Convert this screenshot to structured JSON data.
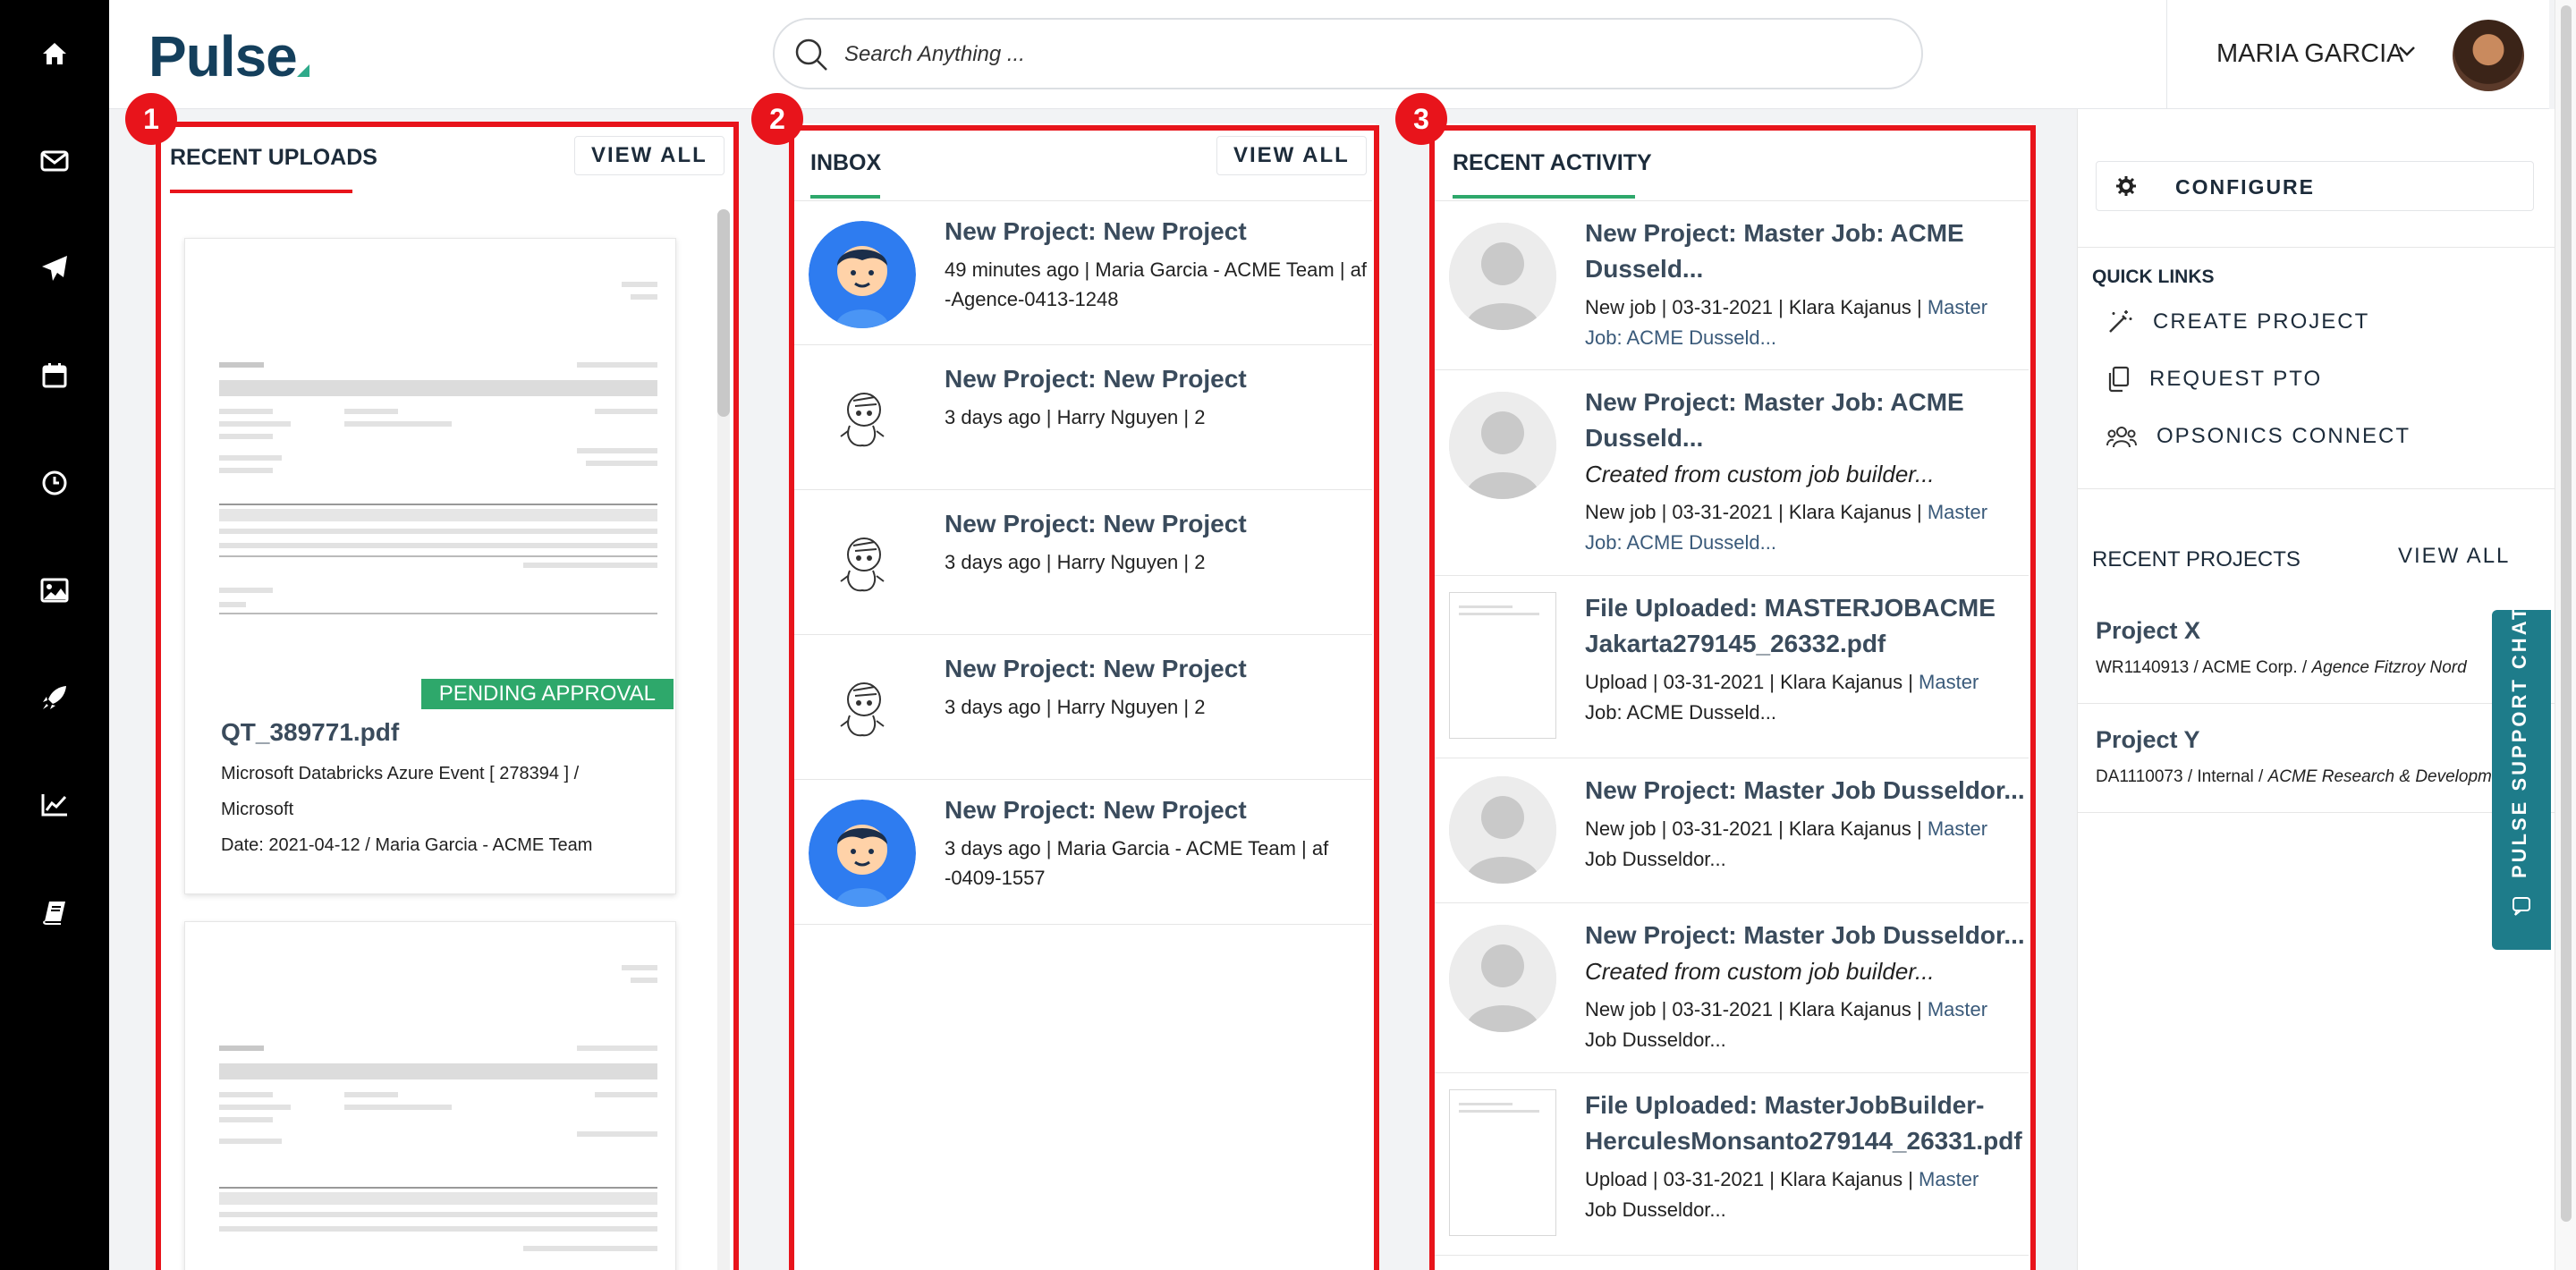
{
  "brand": {
    "name": "Pulse",
    "accent": "#2eaa8a"
  },
  "nav": [
    {
      "icon": "home-icon"
    },
    {
      "icon": "mail-icon"
    },
    {
      "icon": "send-icon"
    },
    {
      "icon": "calendar-icon"
    },
    {
      "icon": "clock-icon"
    },
    {
      "icon": "image-icon"
    },
    {
      "icon": "rocket-icon"
    },
    {
      "icon": "chart-icon"
    },
    {
      "icon": "book-icon"
    }
  ],
  "search": {
    "placeholder": "Search Anything ..."
  },
  "user": {
    "name": "MARIA GARCIA"
  },
  "highlights": {
    "one": "1",
    "two": "2",
    "three": "3",
    "color": "#e8141b"
  },
  "uploads": {
    "title": "RECENT UPLOADS",
    "view_all": "VIEW ALL",
    "items": [
      {
        "status": "PENDING APPROVAL",
        "name": "QT_389771.pdf",
        "meta1": "Microsoft Databricks Azure Event [ 278394 ] /",
        "meta2": "Microsoft",
        "meta3": "Date: 2021-04-12 / Maria Garcia - ACME Team"
      }
    ]
  },
  "inbox": {
    "title": "INBOX",
    "view_all": "VIEW ALL",
    "items": [
      {
        "title": "New Project: New Project",
        "meta1": "49 minutes ago | Maria Garcia - ACME Team | af",
        "meta2": "-Agence-0413-1248"
      },
      {
        "title": "New Project: New Project",
        "meta1": "3 days ago | Harry Nguyen | 2"
      },
      {
        "title": "New Project: New Project",
        "meta1": "3 days ago | Harry Nguyen | 2"
      },
      {
        "title": "New Project: New Project",
        "meta1": "3 days ago | Harry Nguyen | 2"
      },
      {
        "title": "New Project: New Project",
        "meta1": "3 days ago | Maria Garcia - ACME Team | af",
        "meta2": "-0409-1557"
      }
    ]
  },
  "activity": {
    "title": "RECENT ACTIVITY",
    "items": [
      {
        "title1": "New Project: Master Job: ACME",
        "title2": "Dusseld...",
        "meta_a": "New job | 03-31-2021 | Klara Kajanus | ",
        "meta_link_a": "Master",
        "meta_link_b": "Job: ACME Dusseld..."
      },
      {
        "title1": "New Project: Master Job: ACME",
        "title2": "Dusseld...",
        "subtitle": "Created from custom job builder...",
        "meta_a": "New job | 03-31-2021 | Klara Kajanus | ",
        "meta_link_a": "Master",
        "meta_link_b": "Job: ACME Dusseld..."
      },
      {
        "title1": "File Uploaded: MASTERJOBACME",
        "title2": "Jakarta279145_26332.pdf",
        "meta_a": "Upload | 03-31-2021 | Klara Kajanus | ",
        "meta_link_a": "Master",
        "meta_b": "Job: ACME Dusseld..."
      },
      {
        "title1": "New Project: Master Job Dusseldor...",
        "meta_a": "New job | 03-31-2021 | Klara Kajanus | ",
        "meta_link_a": "Master",
        "meta_b": "Job Dusseldor..."
      },
      {
        "title1": "New Project: Master Job Dusseldor...",
        "subtitle": "Created from custom job builder...",
        "meta_a": "New job | 03-31-2021 | Klara Kajanus | ",
        "meta_link_a": "Master",
        "meta_b": "Job Dusseldor..."
      },
      {
        "title1": "File Uploaded: MasterJobBuilder-",
        "title2": "HerculesMonsanto279144_26331.pdf",
        "meta_a": "Upload | 03-31-2021 | Klara Kajanus | ",
        "meta_link_a": "Master",
        "meta_b": "Job Dusseldor..."
      }
    ]
  },
  "sidebar": {
    "configure": "CONFIGURE",
    "quick_links_title": "QUICK LINKS",
    "quick_links": [
      {
        "label": "CREATE PROJECT",
        "icon": "magic-wand-icon"
      },
      {
        "label": "REQUEST PTO",
        "icon": "copy-icon"
      },
      {
        "label": "OPSONICS CONNECT",
        "icon": "users-icon"
      }
    ],
    "recent_projects_title": "RECENT PROJECTS",
    "view_all": "VIEW ALL",
    "projects": [
      {
        "title": "Project X",
        "meta": "WR1140913 / ACME Corp. / ",
        "meta_italic": "Agence Fitzroy Nord"
      },
      {
        "title": "Project Y",
        "meta": "DA1110073 / Internal / ",
        "meta_italic": "ACME Research & Development"
      }
    ],
    "support_chat": "PULSE SUPPORT CHAT"
  }
}
